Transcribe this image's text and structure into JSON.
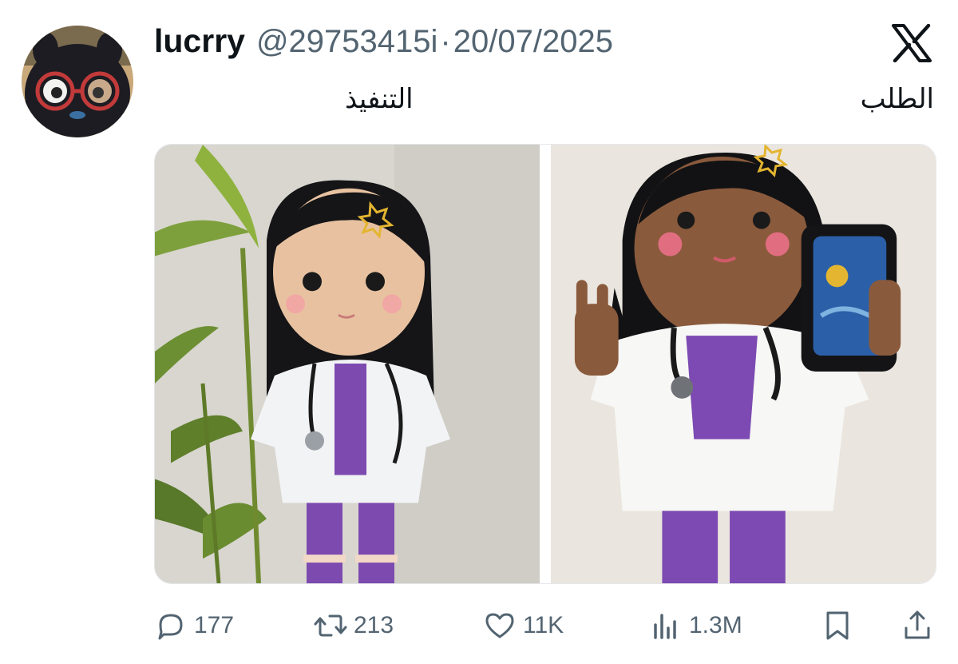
{
  "post": {
    "author_name": "lucrry",
    "handle": "@29753415i",
    "separator": "·",
    "date": "20/07/2025",
    "caption_left": "التنفيذ",
    "caption_right": "الطلب"
  },
  "icons": {
    "platform": "x-logo-icon",
    "reply": "comment-bubble-icon",
    "repost": "repost-arrows-icon",
    "like": "heart-icon",
    "views": "bar-chart-icon",
    "bookmark": "bookmark-icon",
    "share": "share-upload-icon"
  },
  "actions": {
    "replies": "177",
    "reposts": "213",
    "likes": "11K",
    "views": "1.3M"
  },
  "colors": {
    "text_primary": "#0f1419",
    "text_secondary": "#536471",
    "background": "#ffffff"
  }
}
